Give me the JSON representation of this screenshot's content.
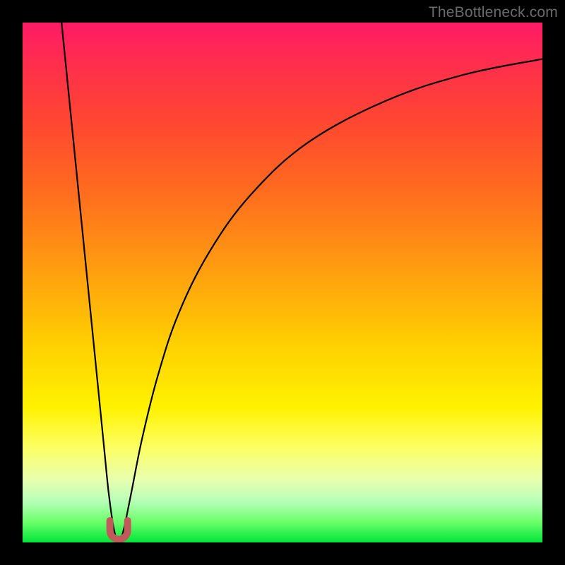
{
  "watermark": "TheBottleneck.com",
  "colors": {
    "frame": "#000000",
    "curve": "#000000",
    "marker": "#c15a5a",
    "gradient_top": "#ff1a66",
    "gradient_mid": "#fff200",
    "gradient_bottom": "#00e639"
  },
  "chart_data": {
    "type": "line",
    "title": "",
    "xlabel": "",
    "ylabel": "",
    "xlim": [
      0,
      100
    ],
    "ylim": [
      0,
      100
    ],
    "grid": false,
    "legend": false,
    "annotations": [],
    "series": [
      {
        "name": "left-branch",
        "x": [
          7.5,
          9.5,
          11.5,
          13.5,
          15.5,
          16.5,
          17.3,
          17.8
        ],
        "y": [
          100,
          80,
          60,
          40,
          20,
          10,
          4,
          1.5
        ]
      },
      {
        "name": "right-branch",
        "x": [
          19.2,
          19.8,
          21.0,
          23.0,
          26.0,
          30.0,
          36.0,
          44.0,
          55.0,
          70.0,
          85.0,
          100.0
        ],
        "y": [
          1.5,
          4,
          10,
          20,
          32,
          44,
          56,
          67,
          77,
          85,
          90,
          93
        ]
      }
    ],
    "marker": {
      "name": "minimum-marker-u-shape",
      "x_center": 18.5,
      "y_bottom": 0.6,
      "width": 3.4,
      "height": 3.6
    }
  }
}
